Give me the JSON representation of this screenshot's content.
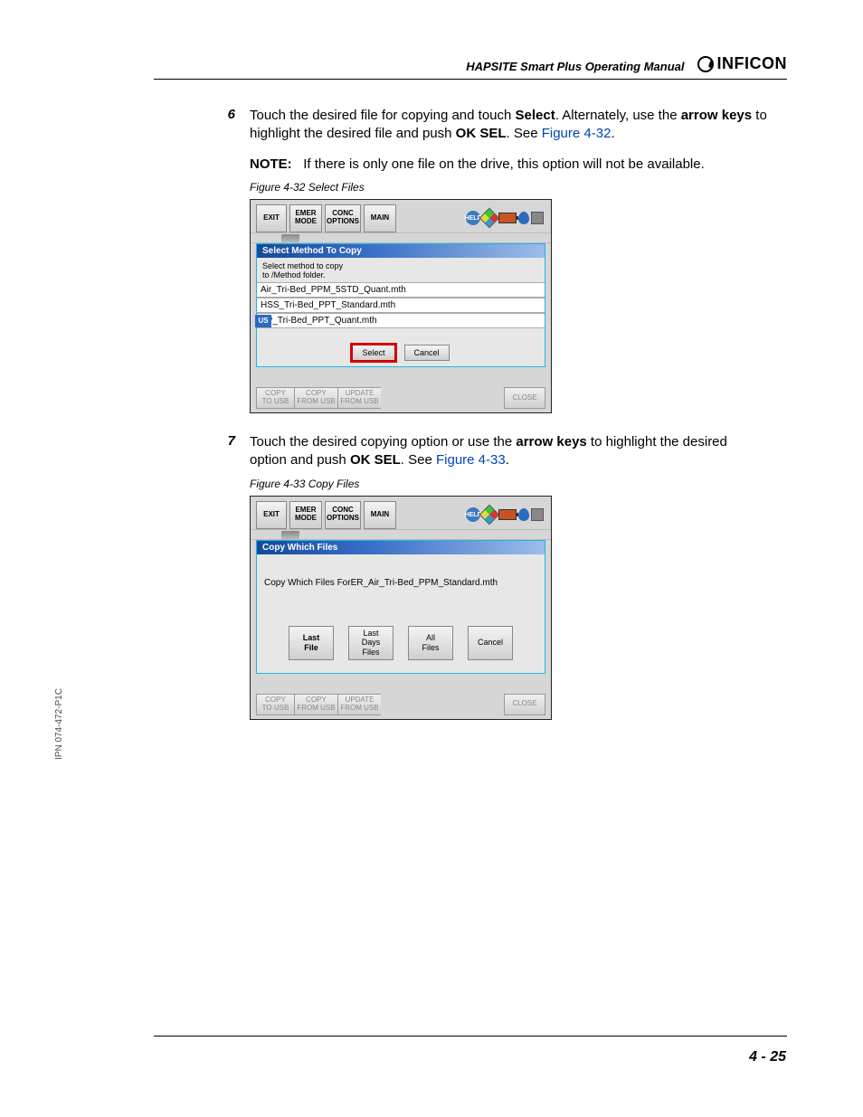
{
  "header": {
    "manual_title": "HAPSITE Smart Plus Operating Manual",
    "brand": "INFICON"
  },
  "side_label": "IPN 074-472-P1C",
  "page_number": "4 - 25",
  "steps": {
    "s6": {
      "num": "6",
      "text_pre": "Touch the desired file for copying and touch ",
      "b1": "Select",
      "text_mid": ". Alternately, use the ",
      "b2": "arrow keys",
      "text_mid2": " to highlight the desired file and push ",
      "b3": "OK SEL",
      "text_end": ". See ",
      "link": "Figure 4-32",
      "period": "."
    },
    "note": {
      "label": "NOTE:",
      "text": "If there is only one file on the drive, this option will not be available."
    },
    "s7": {
      "num": "7",
      "text_pre": "Touch the desired copying option or use the ",
      "b1": "arrow keys",
      "text_mid": " to highlight the desired option and push ",
      "b2": "OK SEL",
      "text_end": ". See ",
      "link": "Figure 4-33",
      "period": "."
    }
  },
  "figures": {
    "f32": {
      "caption": "Figure 4-32  Select Files"
    },
    "f33": {
      "caption": "Figure 4-33  Copy Files"
    }
  },
  "screenshot32": {
    "top": {
      "exit": "EXIT",
      "emer": "EMER\nMODE",
      "conc": "CONC\nOPTIONS",
      "main": "MAIN",
      "help": "HELP",
      "info": "INFO"
    },
    "header": "Select Method To Copy",
    "instr_l1": "Select method to copy",
    "instr_l2": "to /Method folder.",
    "files": [
      "Air_Tri-Bed_PPM_5STD_Quant.mth",
      "HSS_Tri-Bed_PPT_Standard.mth",
      "SP_Tri-Bed_PPT_Quant.mth"
    ],
    "us_tag": "US",
    "select": "Select",
    "cancel": "Cancel",
    "bottom": {
      "copy_to_usb": "COPY\nTO USB",
      "copy_from_usb": "COPY\nFROM USB",
      "update_from_usb": "UPDATE\nFROM USB",
      "close": "CLOSE"
    }
  },
  "screenshot33": {
    "top": {
      "exit": "EXIT",
      "emer": "EMER\nMODE",
      "conc": "CONC\nOPTIONS",
      "main": "MAIN",
      "help": "HELP",
      "info": "INFO"
    },
    "header": "Copy Which Files",
    "prompt": "Copy Which Files ForER_Air_Tri-Bed_PPM_Standard.mth",
    "options": {
      "last_file": "Last\nFile",
      "last_days": "Last\nDays\nFiles",
      "all_files": "All\nFiles",
      "cancel": "Cancel"
    },
    "bottom": {
      "copy_to_usb": "COPY\nTO USB",
      "copy_from_usb": "COPY\nFROM USB",
      "update_from_usb": "UPDATE\nFROM USB",
      "close": "CLOSE"
    }
  }
}
